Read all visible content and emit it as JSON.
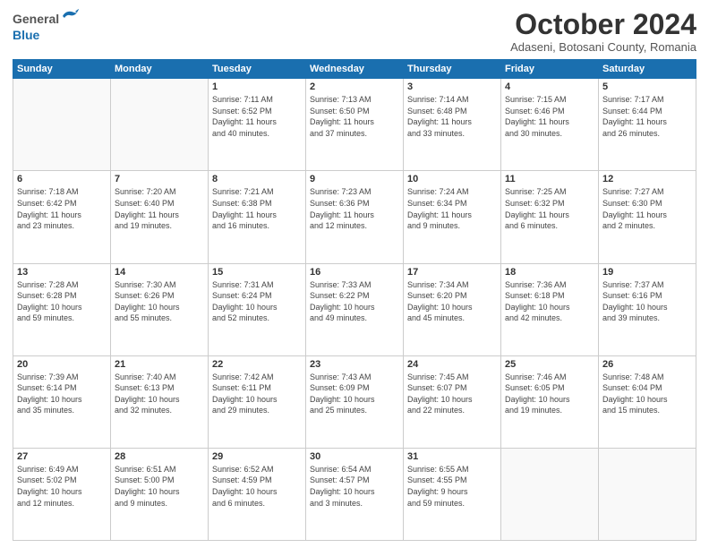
{
  "header": {
    "logo_general": "General",
    "logo_blue": "Blue",
    "month": "October 2024",
    "location": "Adaseni, Botosani County, Romania"
  },
  "weekdays": [
    "Sunday",
    "Monday",
    "Tuesday",
    "Wednesday",
    "Thursday",
    "Friday",
    "Saturday"
  ],
  "weeks": [
    [
      {
        "day": "",
        "info": ""
      },
      {
        "day": "",
        "info": ""
      },
      {
        "day": "1",
        "info": "Sunrise: 7:11 AM\nSunset: 6:52 PM\nDaylight: 11 hours\nand 40 minutes."
      },
      {
        "day": "2",
        "info": "Sunrise: 7:13 AM\nSunset: 6:50 PM\nDaylight: 11 hours\nand 37 minutes."
      },
      {
        "day": "3",
        "info": "Sunrise: 7:14 AM\nSunset: 6:48 PM\nDaylight: 11 hours\nand 33 minutes."
      },
      {
        "day": "4",
        "info": "Sunrise: 7:15 AM\nSunset: 6:46 PM\nDaylight: 11 hours\nand 30 minutes."
      },
      {
        "day": "5",
        "info": "Sunrise: 7:17 AM\nSunset: 6:44 PM\nDaylight: 11 hours\nand 26 minutes."
      }
    ],
    [
      {
        "day": "6",
        "info": "Sunrise: 7:18 AM\nSunset: 6:42 PM\nDaylight: 11 hours\nand 23 minutes."
      },
      {
        "day": "7",
        "info": "Sunrise: 7:20 AM\nSunset: 6:40 PM\nDaylight: 11 hours\nand 19 minutes."
      },
      {
        "day": "8",
        "info": "Sunrise: 7:21 AM\nSunset: 6:38 PM\nDaylight: 11 hours\nand 16 minutes."
      },
      {
        "day": "9",
        "info": "Sunrise: 7:23 AM\nSunset: 6:36 PM\nDaylight: 11 hours\nand 12 minutes."
      },
      {
        "day": "10",
        "info": "Sunrise: 7:24 AM\nSunset: 6:34 PM\nDaylight: 11 hours\nand 9 minutes."
      },
      {
        "day": "11",
        "info": "Sunrise: 7:25 AM\nSunset: 6:32 PM\nDaylight: 11 hours\nand 6 minutes."
      },
      {
        "day": "12",
        "info": "Sunrise: 7:27 AM\nSunset: 6:30 PM\nDaylight: 11 hours\nand 2 minutes."
      }
    ],
    [
      {
        "day": "13",
        "info": "Sunrise: 7:28 AM\nSunset: 6:28 PM\nDaylight: 10 hours\nand 59 minutes."
      },
      {
        "day": "14",
        "info": "Sunrise: 7:30 AM\nSunset: 6:26 PM\nDaylight: 10 hours\nand 55 minutes."
      },
      {
        "day": "15",
        "info": "Sunrise: 7:31 AM\nSunset: 6:24 PM\nDaylight: 10 hours\nand 52 minutes."
      },
      {
        "day": "16",
        "info": "Sunrise: 7:33 AM\nSunset: 6:22 PM\nDaylight: 10 hours\nand 49 minutes."
      },
      {
        "day": "17",
        "info": "Sunrise: 7:34 AM\nSunset: 6:20 PM\nDaylight: 10 hours\nand 45 minutes."
      },
      {
        "day": "18",
        "info": "Sunrise: 7:36 AM\nSunset: 6:18 PM\nDaylight: 10 hours\nand 42 minutes."
      },
      {
        "day": "19",
        "info": "Sunrise: 7:37 AM\nSunset: 6:16 PM\nDaylight: 10 hours\nand 39 minutes."
      }
    ],
    [
      {
        "day": "20",
        "info": "Sunrise: 7:39 AM\nSunset: 6:14 PM\nDaylight: 10 hours\nand 35 minutes."
      },
      {
        "day": "21",
        "info": "Sunrise: 7:40 AM\nSunset: 6:13 PM\nDaylight: 10 hours\nand 32 minutes."
      },
      {
        "day": "22",
        "info": "Sunrise: 7:42 AM\nSunset: 6:11 PM\nDaylight: 10 hours\nand 29 minutes."
      },
      {
        "day": "23",
        "info": "Sunrise: 7:43 AM\nSunset: 6:09 PM\nDaylight: 10 hours\nand 25 minutes."
      },
      {
        "day": "24",
        "info": "Sunrise: 7:45 AM\nSunset: 6:07 PM\nDaylight: 10 hours\nand 22 minutes."
      },
      {
        "day": "25",
        "info": "Sunrise: 7:46 AM\nSunset: 6:05 PM\nDaylight: 10 hours\nand 19 minutes."
      },
      {
        "day": "26",
        "info": "Sunrise: 7:48 AM\nSunset: 6:04 PM\nDaylight: 10 hours\nand 15 minutes."
      }
    ],
    [
      {
        "day": "27",
        "info": "Sunrise: 6:49 AM\nSunset: 5:02 PM\nDaylight: 10 hours\nand 12 minutes."
      },
      {
        "day": "28",
        "info": "Sunrise: 6:51 AM\nSunset: 5:00 PM\nDaylight: 10 hours\nand 9 minutes."
      },
      {
        "day": "29",
        "info": "Sunrise: 6:52 AM\nSunset: 4:59 PM\nDaylight: 10 hours\nand 6 minutes."
      },
      {
        "day": "30",
        "info": "Sunrise: 6:54 AM\nSunset: 4:57 PM\nDaylight: 10 hours\nand 3 minutes."
      },
      {
        "day": "31",
        "info": "Sunrise: 6:55 AM\nSunset: 4:55 PM\nDaylight: 9 hours\nand 59 minutes."
      },
      {
        "day": "",
        "info": ""
      },
      {
        "day": "",
        "info": ""
      }
    ]
  ]
}
